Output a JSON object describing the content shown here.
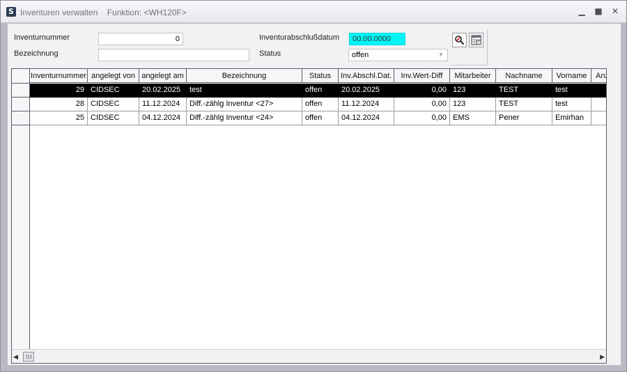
{
  "window": {
    "title": "Inventuren verwalten",
    "function": "Funktion: <WH120F>",
    "app_icon_glyph": "S",
    "min_glyph": "▁",
    "max_glyph": "■",
    "close_glyph": "✕"
  },
  "form": {
    "inventurnummer_label": "Inventurnummer",
    "inventurnummer_value": "0",
    "bezeichnung_label": "Bezeichnung",
    "bezeichnung_value": "",
    "inventurabschluss_label": "Inventurabschlußdatum",
    "inventurabschluss_value": "00.00.0000",
    "status_label": "Status",
    "status_value": "offen",
    "status_arrow": "▼"
  },
  "toolbar": {
    "search_icon": "search-icon",
    "export_icon": "table-export-icon"
  },
  "grid": {
    "columns": [
      "Inventurnummer",
      "angelegt von",
      "angelegt am",
      "Bezeichnung",
      "Status",
      "Inv.Abschl.Dat.",
      "Inv.Wert-Diff",
      "Mitarbeiter",
      "Nachname",
      "Vorname",
      "Anz"
    ],
    "rows": [
      [
        "29",
        "CIDSEC",
        "20.02.2025",
        "test",
        "offen",
        "20.02.2025",
        "0,00",
        "123",
        "TEST",
        "test",
        ""
      ],
      [
        "28",
        "CIDSEC",
        "11.12.2024",
        "Diff.-zählg Inventur <27>",
        "offen",
        "11.12.2024",
        "0,00",
        "123",
        "TEST",
        "test",
        ""
      ],
      [
        "25",
        "CIDSEC",
        "04.12.2024",
        "Diff.-zählg Inventur <24>",
        "offen",
        "04.12.2024",
        "0,00",
        "EMS",
        "Pener",
        "Emirhan",
        ""
      ]
    ],
    "selected_row": 0
  },
  "scrollbar": {
    "left_arrow": "◀",
    "right_arrow": "▶"
  },
  "colors": {
    "accent_cyan": "#00f6f6",
    "selection": "#000000"
  }
}
